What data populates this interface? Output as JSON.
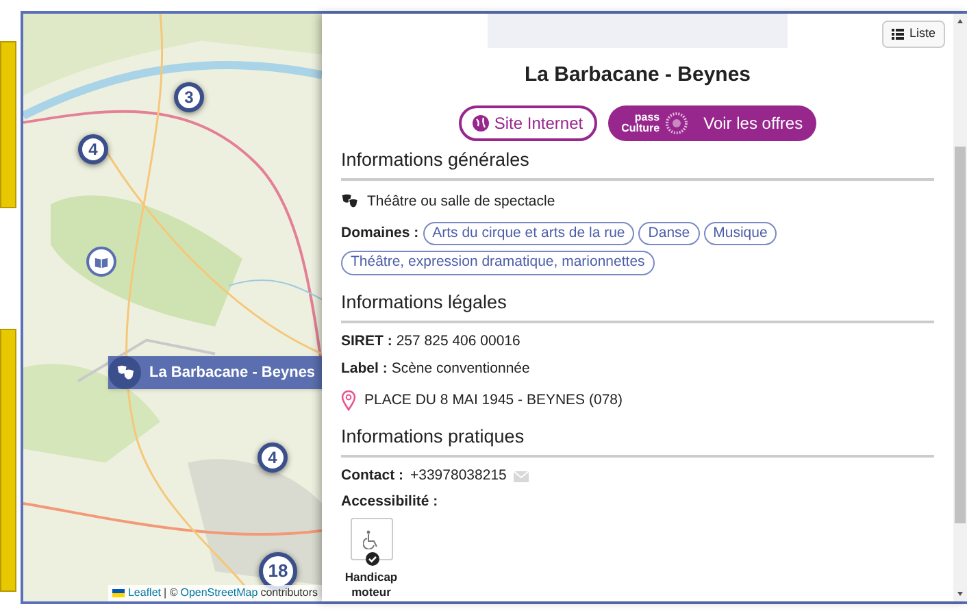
{
  "map": {
    "markers": [
      {
        "kind": "cluster",
        "count": "3"
      },
      {
        "kind": "cluster",
        "count": "4"
      },
      {
        "kind": "place"
      },
      {
        "kind": "cluster",
        "count": "4"
      },
      {
        "kind": "cluster",
        "count": "18"
      }
    ],
    "tooltip": {
      "label": "La Barbacane - Beynes"
    },
    "attribution": {
      "link1": "Leaflet",
      "separator": "| ©",
      "link2": "OpenStreetMap",
      "suffix": "contributors"
    }
  },
  "panel": {
    "list_button": "Liste",
    "title": "La Barbacane - Beynes",
    "website_button": "Site Internet",
    "pass_culture": {
      "logo_line1": "pass",
      "logo_line2": "Culture",
      "label": "Voir les offres"
    },
    "general": {
      "heading": "Informations générales",
      "category": "Théâtre ou salle de spectacle",
      "domains_label": "Domaines :",
      "domains": [
        "Arts du cirque et arts de la rue",
        "Danse",
        "Musique",
        "Théâtre, expression dramatique, marionnettes"
      ]
    },
    "legal": {
      "heading": "Informations légales",
      "siret_label": "SIRET :",
      "siret": "257 825 406 00016",
      "label_label": "Label :",
      "label": "Scène conventionnée",
      "address": "PLACE DU 8 MAI 1945 - BEYNES (078)"
    },
    "practical": {
      "heading": "Informations pratiques",
      "contact_label": "Contact :",
      "contact": "+33978038215",
      "accessibility_label": "Accessibilité :",
      "accessibility": [
        {
          "label": "Handicap moteur",
          "checked": true
        }
      ]
    }
  }
}
